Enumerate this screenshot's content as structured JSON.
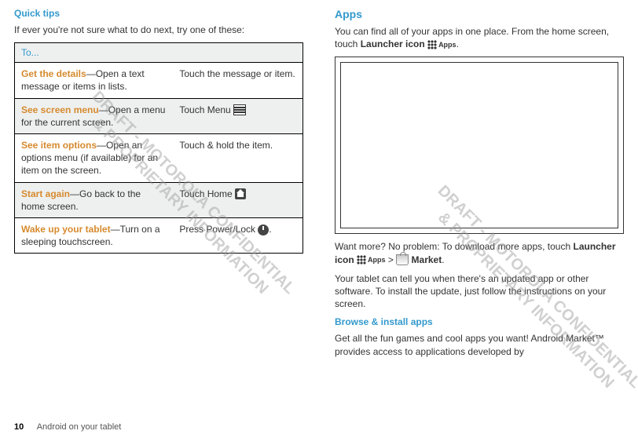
{
  "left": {
    "heading": "Quick tips",
    "intro": "If ever you're not sure what to do next, try one of these:",
    "table": {
      "header": "To...",
      "rows": [
        {
          "term": "Get the details",
          "desc": "—Open a text message or items in lists.",
          "action": "Touch the message or item."
        },
        {
          "term": "See screen menu",
          "desc": "—Open a menu for the current screen.",
          "action_prefix": "Touch Menu "
        },
        {
          "term": "See item options",
          "desc": "—Open an options menu (if available) for an item on the screen.",
          "action": "Touch & hold the item."
        },
        {
          "term": "Start again",
          "desc": "—Go back to the home screen.",
          "action_prefix": "Touch Home "
        },
        {
          "term": "Wake up your tablet",
          "desc": "—Turn on a sleeping touchscreen.",
          "action_prefix": "Press Power/Lock ",
          "action_suffix": "."
        }
      ]
    }
  },
  "right": {
    "heading": "Apps",
    "intro_part1": "You can find all of your apps in one place. From the home screen, touch ",
    "intro_bold": "Launcher icon",
    "intro_after_icon_label": "Apps",
    "intro_end": ".",
    "wantmore_part1": "Want more? No problem: To download more apps, touch ",
    "wantmore_bold1": "Launcher icon",
    "wantmore_icon_label": "Apps",
    "wantmore_gt": " > ",
    "wantmore_bold2": "Market",
    "wantmore_end": ".",
    "update_text": "Your tablet can tell you when there's an updated app or other software. To install the update, just follow the instructions on your screen.",
    "browse_heading": "Browse & install apps",
    "browse_text": "Get all the fun games and cool apps you want! Android Market™ provides access to applications developed by"
  },
  "footer": {
    "page": "10",
    "title": "Android on your tablet"
  },
  "watermark": {
    "line1": "DRAFT - MOTOROLA CONFIDENTIAL",
    "line2": "& PROPRIETARY INFORMATION"
  }
}
